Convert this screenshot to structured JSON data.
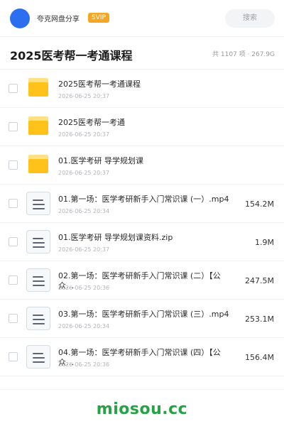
{
  "topbar": {
    "sharer_name": "夸克网盘分享",
    "badge": "SVIP",
    "search_label": "搜索"
  },
  "header": {
    "title": "2025医考帮一考通课程",
    "meta": "共 1107 项 · 267.9G"
  },
  "files": [
    {
      "type": "folder",
      "name": "2025医考帮一考通课程",
      "date": "2026-06-25 20:37",
      "size": ""
    },
    {
      "type": "folder",
      "name": "2025医考帮一考通",
      "date": "2026-06-25 20:37",
      "size": ""
    },
    {
      "type": "folder",
      "name": "01.医学考研 导学规划课",
      "date": "2026-06-25 20:37",
      "size": ""
    },
    {
      "type": "file",
      "name": "01.第一场：医学考研新手入门常识课 (一）.mp4",
      "date": "2026-06-25 20:34",
      "size": "154.2M"
    },
    {
      "type": "file",
      "name": "01.医学考研 导学规划课资料.zip",
      "date": "2026-06-25 20:37",
      "size": "1.9M"
    },
    {
      "type": "file",
      "name": "02.第一场：医学考研新手入门常识课 (二）【公众…",
      "date": "2026-06-25 20:36",
      "size": "247.5M"
    },
    {
      "type": "file",
      "name": "03.第一场：医学考研新手入门常识课 (三）.mp4",
      "date": "2026-06-25 20:34",
      "size": "253.1M"
    },
    {
      "type": "file",
      "name": "04.第一场：医学考研新手入门常识课 (四）【公众…",
      "date": "2026-06-25 20:36",
      "size": "156.4M"
    }
  ],
  "footer": {
    "watermark": "miosou.cc"
  }
}
